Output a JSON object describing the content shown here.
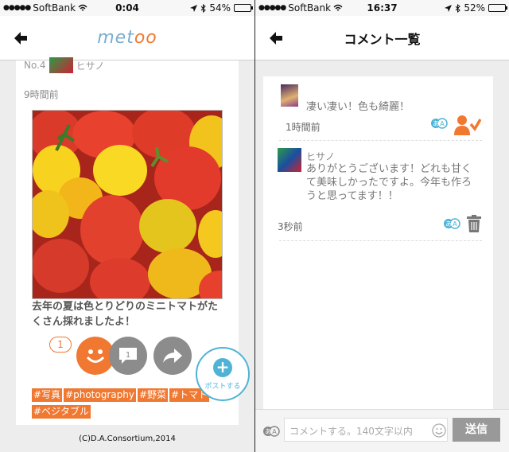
{
  "left": {
    "status": {
      "carrier": "SoftBank",
      "time": "0:04",
      "battery": "54%",
      "battery_level": 0.54
    },
    "nav": {
      "logo_prefix": "met",
      "logo_suffix": "oo"
    },
    "post": {
      "user_no": "No.4",
      "user_name": "ヒサノ",
      "time_ago": "9時間前",
      "caption": "去年の夏は色とりどりのミニトマトがたくさん採れましたよ！",
      "like_count": "1",
      "tags": [
        "#写真",
        "#photography",
        "#野菜",
        "#トマト",
        "#ベジタブル"
      ]
    },
    "fab_label": "ポストする",
    "copyright": "(C)D.A.Consortium,2014"
  },
  "right": {
    "status": {
      "carrier": "SoftBank",
      "time": "16:37",
      "battery": "52%",
      "battery_level": 0.52
    },
    "nav": {
      "title": "コメント一覧"
    },
    "comments": [
      {
        "name": "",
        "text": "凄い凄い！色も綺麗！",
        "time_ago": "1時間前"
      },
      {
        "name": "ヒサノ",
        "text": "ありがとうございます！どれも甘くて美味しかったですよ。今年も作ろうと思ってます！！",
        "time_ago": "3秒前"
      }
    ],
    "input": {
      "placeholder": "コメントする。140文字以内"
    },
    "send_label": "送信"
  },
  "colors": {
    "accent": "#f07830",
    "fab": "#4fb3d6",
    "logo": "#7aaed0"
  }
}
